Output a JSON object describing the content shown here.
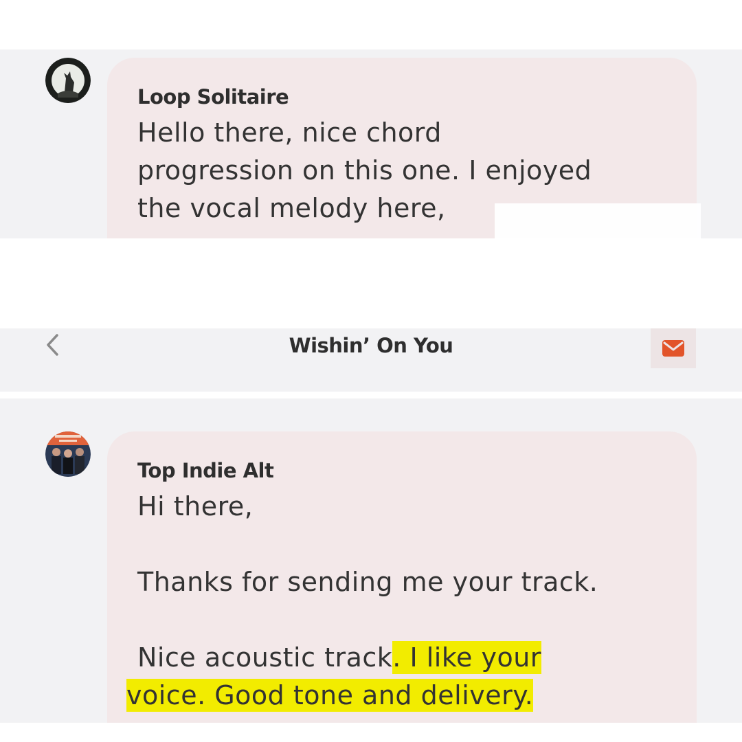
{
  "top_message": {
    "sender": "Loop Solitaire",
    "avatar_icon": "wolf-howling-avatar",
    "lines": [
      "Hello there, nice chord",
      "progression on this one. I enjoyed",
      "the vocal melody here,"
    ]
  },
  "nav": {
    "title": "Wishin’ On You",
    "back_icon": "chevron-left-icon",
    "mail_icon": "envelope-icon",
    "accent_color": "#e2542a"
  },
  "bottom_message": {
    "sender": "Top Indie Alt",
    "avatar_icon": "band-photo-avatar",
    "greeting": "Hi there,",
    "thanks": "Thanks for sending me your track.",
    "line3_plain": "Nice acoustic track",
    "line3_highlight": ". I like your ",
    "line4_highlight": " voice. Good tone and delivery. ",
    "highlight_color": "#f2ec00"
  }
}
